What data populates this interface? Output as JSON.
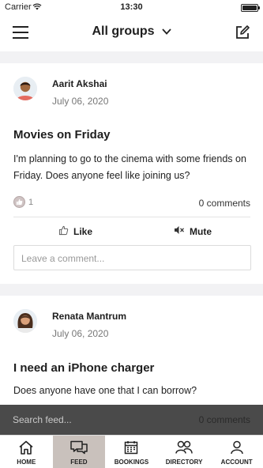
{
  "status_bar": {
    "carrier": "Carrier",
    "time": "13:30"
  },
  "nav": {
    "title": "All groups"
  },
  "posts": [
    {
      "author": "Aarit Akshai",
      "date": "July 06, 2020",
      "title": "Movies on Friday",
      "body": "I'm planning to go to the cinema with some friends on Friday. Does anyone feel like joining us?",
      "likes": "1",
      "comments": "0 comments",
      "like_label": "Like",
      "mute_label": "Mute",
      "comment_placeholder": "Leave a comment..."
    },
    {
      "author": "Renata Mantrum",
      "date": "July 06, 2020",
      "title": "I need an iPhone charger",
      "body": "Does anyone have one that I can borrow?",
      "comments": "0 comments"
    }
  ],
  "search": {
    "placeholder": "Search feed..."
  },
  "tabs": [
    {
      "label": "HOME",
      "icon": "home-icon"
    },
    {
      "label": "FEED",
      "icon": "feed-icon"
    },
    {
      "label": "BOOKINGS",
      "icon": "calendar-icon"
    },
    {
      "label": "DIRECTORY",
      "icon": "directory-icon"
    },
    {
      "label": "ACCOUNT",
      "icon": "account-icon"
    }
  ],
  "colors": {
    "active_tab": "#c9c1bc",
    "search_bar": "#4a4a4a"
  }
}
